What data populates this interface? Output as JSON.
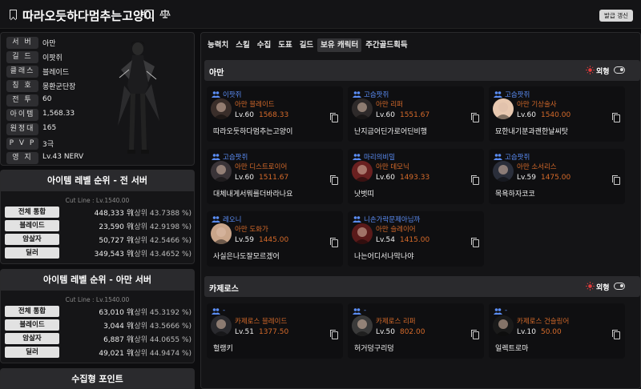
{
  "header": {
    "title": "따라오듯하다멈추는고양이",
    "refresh_label": "발급 갱신"
  },
  "profile": {
    "rows": [
      {
        "key": "서 버",
        "value": "아만"
      },
      {
        "key": "길 드",
        "value": "이팟쥐"
      },
      {
        "key": "클래스",
        "value": "블레이드"
      },
      {
        "key": "칭 호",
        "value": "몽환군단장"
      },
      {
        "key": "전 투",
        "value": "60"
      },
      {
        "key": "아이템",
        "value": "1,568.33"
      },
      {
        "key": "원정대",
        "value": "165"
      },
      {
        "key": "P V P",
        "value": "3극"
      },
      {
        "key": "영 지",
        "value": "Lv.43 NERV"
      }
    ]
  },
  "rank_all": {
    "title": "아이템 레벨 순위 - 전 서버",
    "cutline": "Cut Line : Lv.1540.00",
    "rows": [
      {
        "key": "전체 통합",
        "rank": "448,333 위",
        "pct": "(상위  43.7388 %)"
      },
      {
        "key": "블레이드",
        "rank": "23,590 위",
        "pct": "(상위  42.9198 %)"
      },
      {
        "key": "암살자",
        "rank": "50,727 위",
        "pct": "(상위  42.5466 %)"
      },
      {
        "key": "딜러",
        "rank": "349,543 위",
        "pct": "(상위  43.4652 %)"
      }
    ]
  },
  "rank_server": {
    "title": "아이템 레벨 순위 - 아만 서버",
    "cutline": "Cut Line : Lv.1540.00",
    "rows": [
      {
        "key": "전체 통합",
        "rank": "63,010 위",
        "pct": "(상위  45.3192 %)"
      },
      {
        "key": "블레이드",
        "rank": "3,044 위",
        "pct": "(상위  43.5666 %)"
      },
      {
        "key": "암살자",
        "rank": "6,887 위",
        "pct": "(상위  44.0655 %)"
      },
      {
        "key": "딜러",
        "rank": "49,021 위",
        "pct": "(상위  44.9474 %)"
      }
    ]
  },
  "collect": {
    "title": "수집형 포인트"
  },
  "tabs": [
    "능력치",
    "스킬",
    "수집",
    "도표",
    "길드",
    "보유 캐릭터",
    "주간골드획득"
  ],
  "active_tab": 5,
  "servers": [
    {
      "name": "아만",
      "look_label": "외형",
      "cards": [
        {
          "guild": "이팟쥐",
          "server": "아만",
          "cls": "블레이드",
          "level": "Lv.60",
          "ilvl": "1568.33",
          "name": "따라오듯하다멈추는고양이"
        },
        {
          "guild": "고슴팟쥐",
          "server": "아만",
          "cls": "리퍼",
          "level": "Lv.60",
          "ilvl": "1551.67",
          "name": "난지금어딘가로어딘비행"
        },
        {
          "guild": "고슴팟쥐",
          "server": "아만",
          "cls": "기상술사",
          "level": "Lv.60",
          "ilvl": "1540.00",
          "name": "묘한내기분과괜한날씨탓"
        },
        {
          "guild": "고슴팟쥐",
          "server": "아만",
          "cls": "디스트로이어",
          "level": "Lv.60",
          "ilvl": "1511.67",
          "name": "대체내게서뭐를더바라나요"
        },
        {
          "guild": "마리의비밀",
          "server": "아만",
          "cls": "데모닉",
          "level": "Lv.60",
          "ilvl": "1493.33",
          "name": "낫벗띠"
        },
        {
          "guild": "고슴팟쥐",
          "server": "아만",
          "cls": "소서리스",
          "level": "Lv.59",
          "ilvl": "1475.00",
          "name": "목욕하자코코"
        },
        {
          "guild": "레오니",
          "server": "아만",
          "cls": "도화가",
          "level": "Lv.59",
          "ilvl": "1445.00",
          "name": "사실은나도잘모르겠어"
        },
        {
          "guild": "니손가락문제아님까",
          "server": "아만",
          "cls": "슬레이어",
          "level": "Lv.54",
          "ilvl": "1415.00",
          "name": "나는어디서나막나야"
        }
      ]
    },
    {
      "name": "카제로스",
      "look_label": "외형",
      "cards": [
        {
          "guild": "-",
          "server": "카제로스",
          "cls": "블레이드",
          "level": "Lv.51",
          "ilvl": "1377.50",
          "name": "헐랭키"
        },
        {
          "guild": "-",
          "server": "카제로스",
          "cls": "리퍼",
          "level": "Lv.50",
          "ilvl": "802.00",
          "name": "허거덩구리덩"
        },
        {
          "guild": "-",
          "server": "카제로스",
          "cls": "건슬링어",
          "level": "Lv.10",
          "ilvl": "50.00",
          "name": "일렉트로마"
        }
      ]
    }
  ],
  "colors": {
    "accent_blue": "#5b8df5",
    "accent_orange": "#d56a2a",
    "sun_red": "#e23b3b"
  }
}
